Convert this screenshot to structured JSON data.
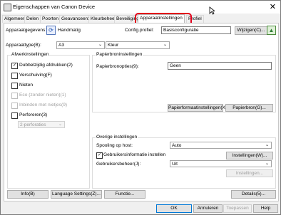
{
  "window": {
    "title": "Eigenschappen van Canon Device",
    "close": "✕"
  },
  "tabs": [
    "Algemeen",
    "Delen",
    "Poorten",
    "Geavanceerd",
    "Kleurbeheer",
    "Beveiliging",
    "Apparaatinstellingen",
    "Profiel"
  ],
  "header": {
    "device_label": "Apparaatgegevens:",
    "manual_label": "Handmatig",
    "config_label": "Config.profiel:",
    "config_value": "Basisconfiguratie",
    "change_btn": "Wijzigen(C)..."
  },
  "device_type": {
    "label": "Apparaattype(B):",
    "value": "A3",
    "color_value": "Kleur"
  },
  "finishing": {
    "title": "Afwerkinstellingen",
    "duplex": "Dubbelzijdig afdrukken(2)",
    "shift": "Verschuiving(F)",
    "staple": "Nieten",
    "eco_staple": "Eco (zonder nieten)(1)",
    "binding_staple": "Inbinden met nietjes(9)",
    "punch": "Perforeren(3)",
    "punch_positions": "2-perforaties"
  },
  "paper_source": {
    "title": "Papierbroninstellingen",
    "options_label": "Papierbronopties(9):",
    "options_value": "Geen",
    "format_btn": "Papierformaatinstellingen(X)...",
    "source_btn": "Papierbron(G)..."
  },
  "other": {
    "title": "Overige instellingen",
    "spooling_label": "Spooling op host:",
    "spooling_value": "Auto",
    "userinfo": "Gebruikersinformatie instellen",
    "settings_w": "Instellingen(W)...",
    "usermgmt_label": "Gebruikersbeheer(J):",
    "usermgmt_value": "Uit",
    "settings_disabled": "Instellingen..."
  },
  "bottom_row": {
    "info": "Info(B)",
    "lang": "Language Settings(Z)...",
    "func": "Functie...",
    "details": "Details(5)..."
  },
  "footer": {
    "ok": "OK",
    "cancel": "Annuleren",
    "apply": "Toepassen",
    "help": "Help"
  }
}
